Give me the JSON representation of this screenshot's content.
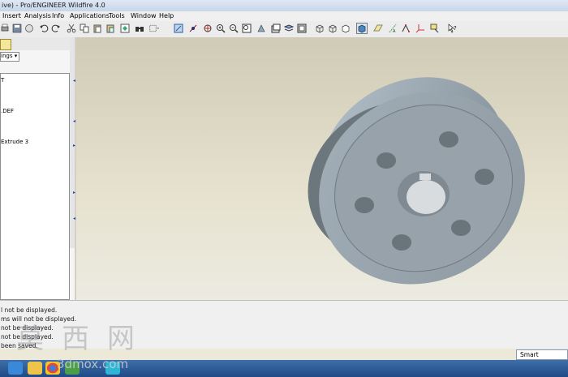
{
  "window": {
    "title": "ive) - Pro/ENGINEER Wildfire 4.0"
  },
  "menu": [
    "Insert",
    "Analysis",
    "Info",
    "Applications",
    "Tools",
    "Window",
    "Help"
  ],
  "left_panel": {
    "dropdown_label": "ings ▾",
    "tree_items": [
      "T",
      ".DEF",
      "Extrude 3"
    ]
  },
  "messages": [
    "l not be displayed.",
    "ms will not be displayed.",
    "not be displayed.",
    "not be displayed.",
    "been saved."
  ],
  "status": {
    "filter_value": "Smart"
  },
  "watermark": {
    "chars": "莫西网",
    "url": "3dmox.com"
  },
  "colors": {
    "viewport_top": "#cfcbb6",
    "viewport_bottom": "#ecebe1",
    "part": "#8f9aa3",
    "part_face": "#9aa5ae"
  }
}
